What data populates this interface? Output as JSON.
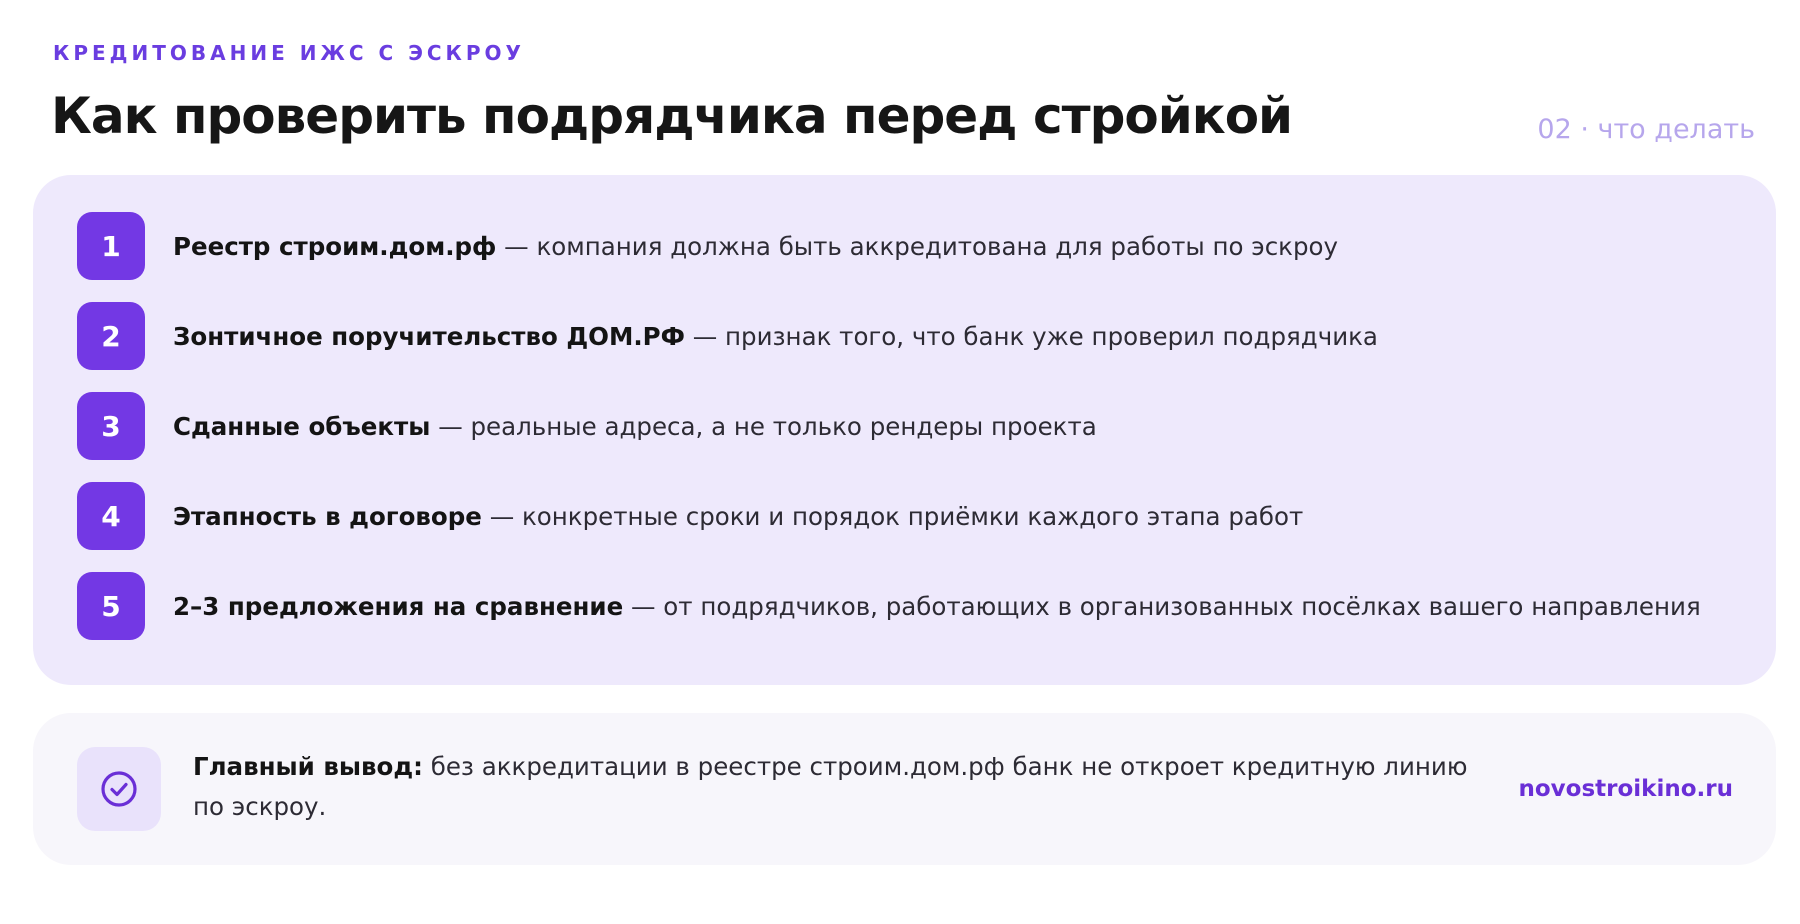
{
  "header": {
    "eyebrow": "КРЕДИТОВАНИЕ ИЖС С ЭСКРОУ",
    "title": "Как проверить подрядчика перед стройкой",
    "section_tag": "02 · что делать"
  },
  "steps": [
    {
      "number": "1",
      "strong": "Реестр строим.дом.рф",
      "rest": " — компания должна быть аккредитована для работы по эскроу"
    },
    {
      "number": "2",
      "strong": "Зонтичное поручительство ДОМ.РФ",
      "rest": " — признак того, что банк уже проверил подрядчика"
    },
    {
      "number": "3",
      "strong": "Сданные объекты",
      "rest": " — реальные адреса, а не только рендеры проекта"
    },
    {
      "number": "4",
      "strong": "Этапность в договоре",
      "rest": " — конкретные сроки и порядок приёмки каждого этапа работ"
    },
    {
      "number": "5",
      "strong": "2–3 предложения на сравнение",
      "rest": " — от подрядчиков, работающих в организованных посёлках вашего направления"
    }
  ],
  "conclusion": {
    "icon": "check-circle-icon",
    "strong": "Главный вывод:",
    "rest": " без аккредитации в реестре строим.дом.рф банк не откроет кредитную линию по эскроу.",
    "site": "novostroikino.ru"
  },
  "colors": {
    "accent": "#7338e4",
    "card_bg": "#eee9fc",
    "conclusion_bg": "#f7f6fb",
    "tag": "#b6a6ec"
  }
}
